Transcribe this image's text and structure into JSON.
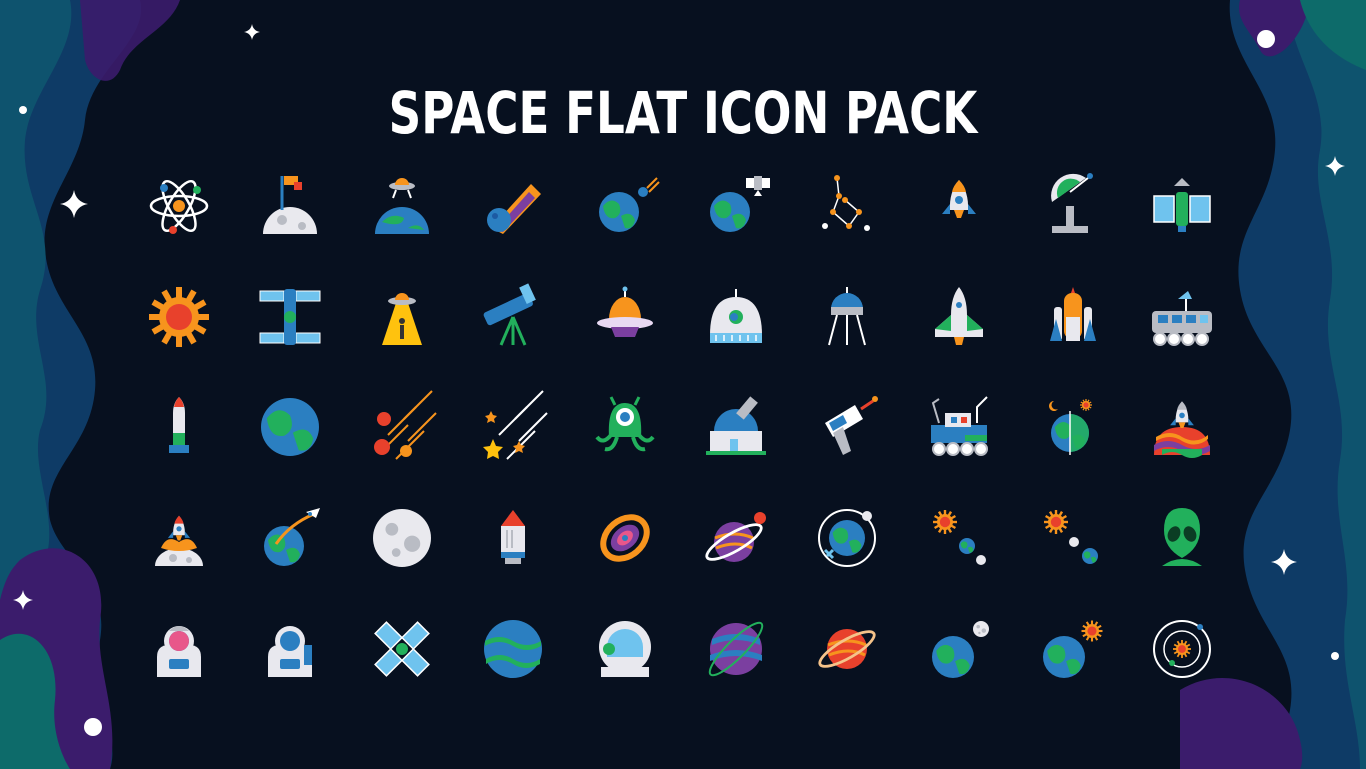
{
  "title": "SPACE FLAT ICON PACK",
  "palette": {
    "background": "#07101f",
    "wave_blue": "#0f3a66",
    "wave_teal": "#0e5f6e",
    "wave_purple": "#3a1b6b",
    "earth_blue": "#2b7fc1",
    "earth_green": "#22b05c",
    "orange": "#f7941d",
    "red": "#e8412c",
    "white": "#ffffff",
    "grey": "#b9bcc4"
  },
  "icons": [
    [
      "atom-icon",
      "moon-flag-icon",
      "ufo-over-earth-icon",
      "comet-icon",
      "earth-meteor-icon",
      "earth-satellite-icon",
      "constellation-icon",
      "rocket-icon",
      "radio-telescope-icon",
      "space-station-icon"
    ],
    [
      "sun-icon",
      "satellite-module-icon",
      "ufo-abduction-icon",
      "telescope-icon",
      "ufo-saucer-icon",
      "space-capsule-icon",
      "lunar-lander-icon",
      "space-shuttle-icon",
      "shuttle-launch-icon",
      "lunar-rover-icon"
    ],
    [
      "missile-icon",
      "planet-earth-icon",
      "meteor-shower-icon",
      "shooting-stars-icon",
      "alien-monster-icon",
      "observatory-icon",
      "ray-gun-icon",
      "mars-rover-icon",
      "day-night-earth-icon",
      "rocket-launch-icon"
    ],
    [
      "moon-rocket-launch-icon",
      "earth-rocket-icon",
      "full-moon-icon",
      "rocket-stage-icon",
      "galaxy-icon",
      "ringed-planet-icon",
      "earth-orbit-icon",
      "sun-earth-moon-icon",
      "sun-moon-earth-icon",
      "alien-head-icon"
    ],
    [
      "astronaut-icon",
      "astronaut-helmet-icon",
      "solar-panel-satellite-icon",
      "planet-neptune-icon",
      "space-helmet-icon",
      "planet-jupiter-icon",
      "planet-saturn-icon",
      "earth-moon-icon",
      "earth-sun-icon",
      "solar-system-icon"
    ]
  ]
}
